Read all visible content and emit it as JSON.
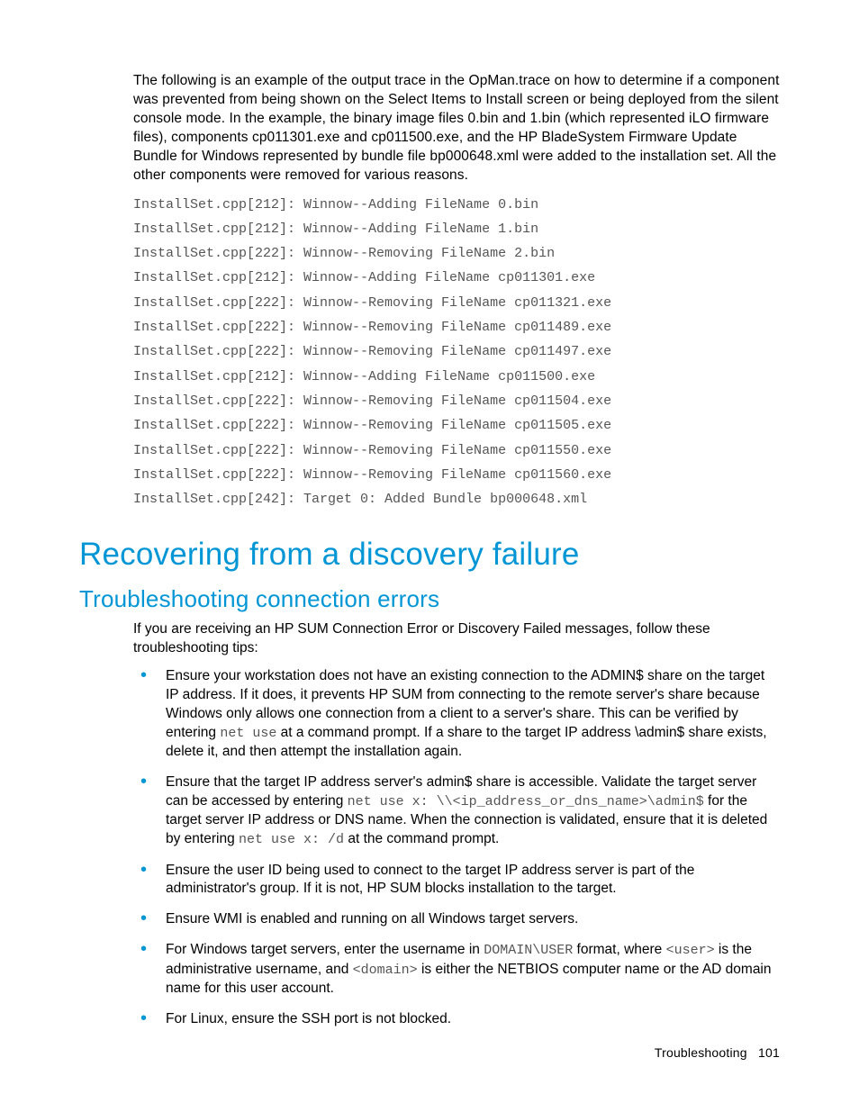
{
  "intro_paragraph": "The following is an example of the output trace in the OpMan.trace on how to determine if a component was prevented from being shown on the Select Items to Install screen or being deployed from the silent console mode. In the example, the binary image files 0.bin and 1.bin (which represented iLO firmware files), components cp011301.exe and cp011500.exe, and the HP BladeSystem Firmware Update Bundle for Windows represented by bundle file bp000648.xml were added to the installation set.   All the other components were removed for various reasons.",
  "trace_lines": [
    "InstallSet.cpp[212]: Winnow--Adding FileName 0.bin",
    "InstallSet.cpp[212]: Winnow--Adding FileName 1.bin",
    "InstallSet.cpp[222]: Winnow--Removing FileName 2.bin",
    "InstallSet.cpp[212]: Winnow--Adding FileName cp011301.exe",
    "InstallSet.cpp[222]: Winnow--Removing FileName cp011321.exe",
    "InstallSet.cpp[222]: Winnow--Removing FileName cp011489.exe",
    "InstallSet.cpp[222]: Winnow--Removing FileName cp011497.exe",
    "InstallSet.cpp[212]: Winnow--Adding FileName cp011500.exe",
    "InstallSet.cpp[222]: Winnow--Removing FileName cp011504.exe",
    "InstallSet.cpp[222]: Winnow--Removing FileName cp011505.exe",
    "InstallSet.cpp[222]: Winnow--Removing FileName cp011550.exe",
    "InstallSet.cpp[222]: Winnow--Removing FileName cp011560.exe",
    "InstallSet.cpp[242]: Target 0: Added Bundle bp000648.xml"
  ],
  "h1": "Recovering from a discovery failure",
  "h2": "Troubleshooting connection errors",
  "tips_intro": "If you are receiving an HP SUM Connection Error or Discovery Failed messages, follow these troubleshooting tips:",
  "bullets": [
    {
      "segments": [
        {
          "t": "text",
          "v": "Ensure your workstation does not have an existing connection to the ADMIN$ share on the target IP address. If it does, it prevents HP SUM from connecting to the remote server's share because Windows only allows one connection from a client to a server's share. This can be verified by entering "
        },
        {
          "t": "mono",
          "v": "net use"
        },
        {
          "t": "text",
          "v": " at a command prompt. If a share to the target IP address \\admin$ share exists, delete it, and then attempt the installation again."
        }
      ]
    },
    {
      "segments": [
        {
          "t": "text",
          "v": "Ensure that the target IP address server's admin$ share is accessible. Validate the target server can be accessed by entering "
        },
        {
          "t": "mono",
          "v": "net use x: \\\\<ip_address_or_dns_name>\\admin$"
        },
        {
          "t": "text",
          "v": " for the target server IP address or DNS name. When the connection is validated, ensure that it is deleted by entering "
        },
        {
          "t": "mono",
          "v": "net use x: /d"
        },
        {
          "t": "text",
          "v": " at the command prompt."
        }
      ]
    },
    {
      "segments": [
        {
          "t": "text",
          "v": "Ensure the user ID being used to connect to the target IP address server is part of the administrator's group. If it is not, HP SUM blocks installation to the target."
        }
      ]
    },
    {
      "segments": [
        {
          "t": "text",
          "v": "Ensure WMI is enabled and running on all Windows target servers."
        }
      ]
    },
    {
      "segments": [
        {
          "t": "text",
          "v": "For Windows target servers, enter the username in "
        },
        {
          "t": "mono",
          "v": "DOMAIN\\USER"
        },
        {
          "t": "text",
          "v": " format, where "
        },
        {
          "t": "mono",
          "v": "<user>"
        },
        {
          "t": "text",
          "v": " is the administrative username, and "
        },
        {
          "t": "mono",
          "v": "<domain>"
        },
        {
          "t": "text",
          "v": " is either the NETBIOS computer name or the AD domain name for this user account."
        }
      ]
    },
    {
      "segments": [
        {
          "t": "text",
          "v": "For Linux, ensure the SSH port is not blocked."
        }
      ]
    }
  ],
  "footer_label": "Troubleshooting",
  "footer_page": "101"
}
